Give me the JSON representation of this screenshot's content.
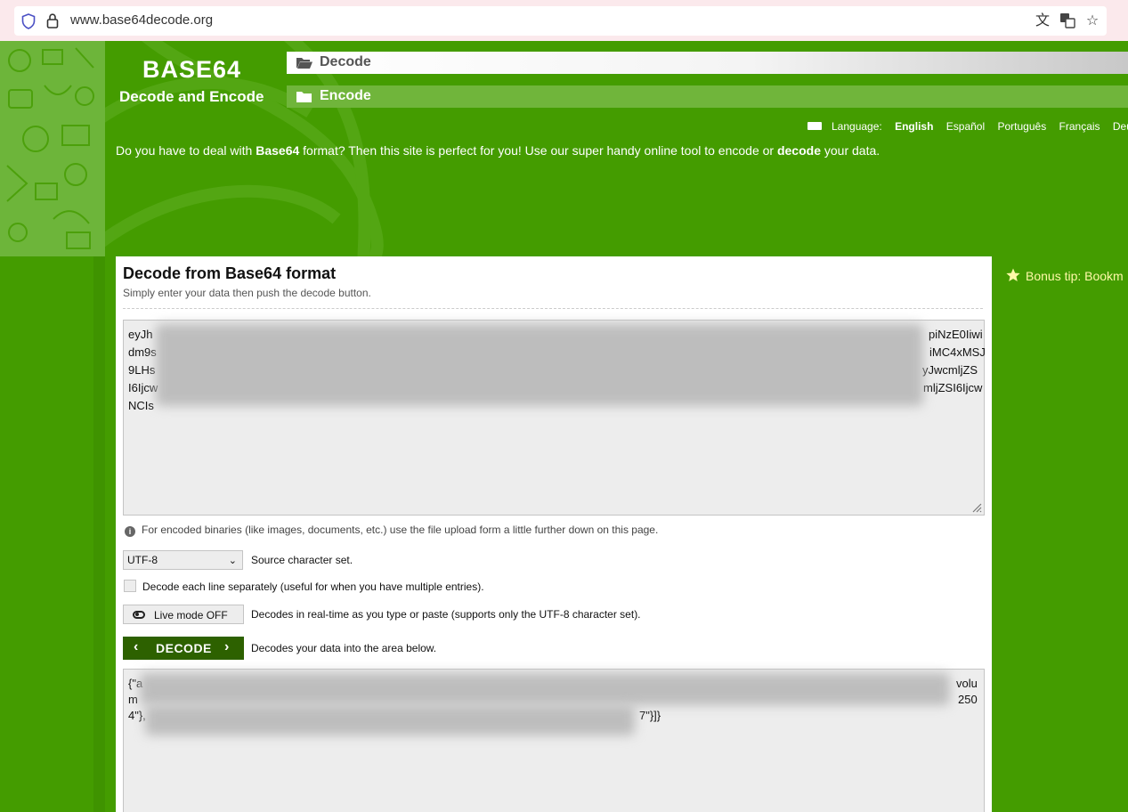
{
  "browser": {
    "url": "www.base64decode.org"
  },
  "header": {
    "logo_title": "BASE64",
    "logo_subtitle": "Decode and Encode",
    "nav": [
      {
        "label": "Decode"
      },
      {
        "label": "Encode"
      }
    ]
  },
  "language": {
    "label": "Language:",
    "options": [
      "English",
      "Español",
      "Português",
      "Français",
      "Deuts"
    ],
    "active": "English"
  },
  "intro": {
    "part1": "Do you have to deal with ",
    "bold1": "Base64",
    "part2": " format? Then this site is perfect for you! Use our super handy online tool to encode or ",
    "bold2": "decode",
    "part3": " your data."
  },
  "bonus_tip": "Bonus tip: Bookm",
  "panel": {
    "title": "Decode from Base64 format",
    "subtitle": "Simply enter your data then push the decode button.",
    "input_lines": [
      {
        "left": "eyJh",
        "right": "piNzE0Iiwi"
      },
      {
        "left": "dm9s",
        "right": "iMC4xMSJ"
      },
      {
        "left": "9LHs",
        "right": "yJwcmljZS"
      },
      {
        "left": "I6Ijcw",
        "right": "mljZSI6Ijcw"
      },
      {
        "left": "NCIs",
        "right": ""
      }
    ],
    "info_text": "For encoded binaries (like images, documents, etc.) use the file upload form a little further down on this page.",
    "charset_value": "UTF-8",
    "charset_label": "Source character set.",
    "checkbox_label": "Decode each line separately (useful for when you have multiple entries).",
    "live_mode_label": "Live mode OFF",
    "live_mode_desc": "Decodes in real-time as you type or paste (supports only the UTF-8 character set).",
    "decode_label": "DECODE",
    "decode_desc": "Decodes your data into the area below.",
    "output_lines": [
      {
        "left": "{\"a",
        "right": "volu"
      },
      {
        "left": "m",
        "right": "250"
      },
      {
        "left": "4\"},",
        "right": "7\"}]}"
      }
    ]
  },
  "colors": {
    "brand_green": "#449c00",
    "dark_green": "#2d6100",
    "bonus_yellow": "#fff9a8"
  }
}
